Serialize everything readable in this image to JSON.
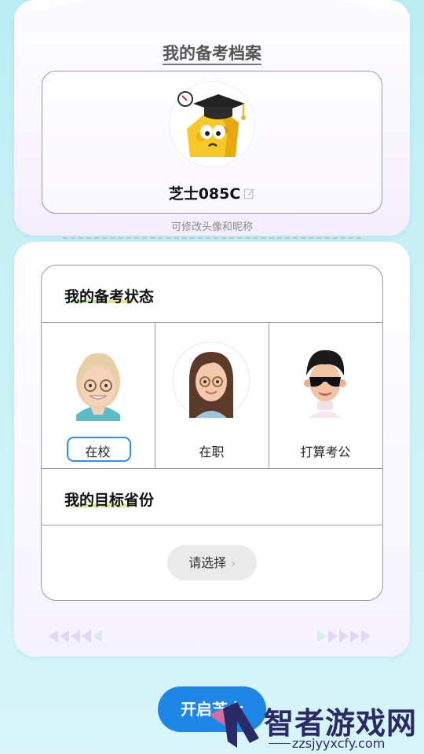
{
  "page": {
    "title": "我的备考档案",
    "nickname": "芝士085C",
    "hint": "可修改头像和昵称"
  },
  "status_section": {
    "title": "我的备考状态",
    "options": [
      {
        "label": "在校",
        "selected": true
      },
      {
        "label": "在职",
        "selected": false
      },
      {
        "label": "打算考公",
        "selected": false
      }
    ]
  },
  "province_section": {
    "title": "我的目标省份",
    "select_label": "请选择"
  },
  "footer": {
    "start_button": "开启芝士",
    "watermark_text": "智者游戏网",
    "watermark_url": "zzsjyyxcfy.com"
  },
  "colors": {
    "accent": "#1e86e6",
    "selected_border": "#2f8fe0"
  }
}
